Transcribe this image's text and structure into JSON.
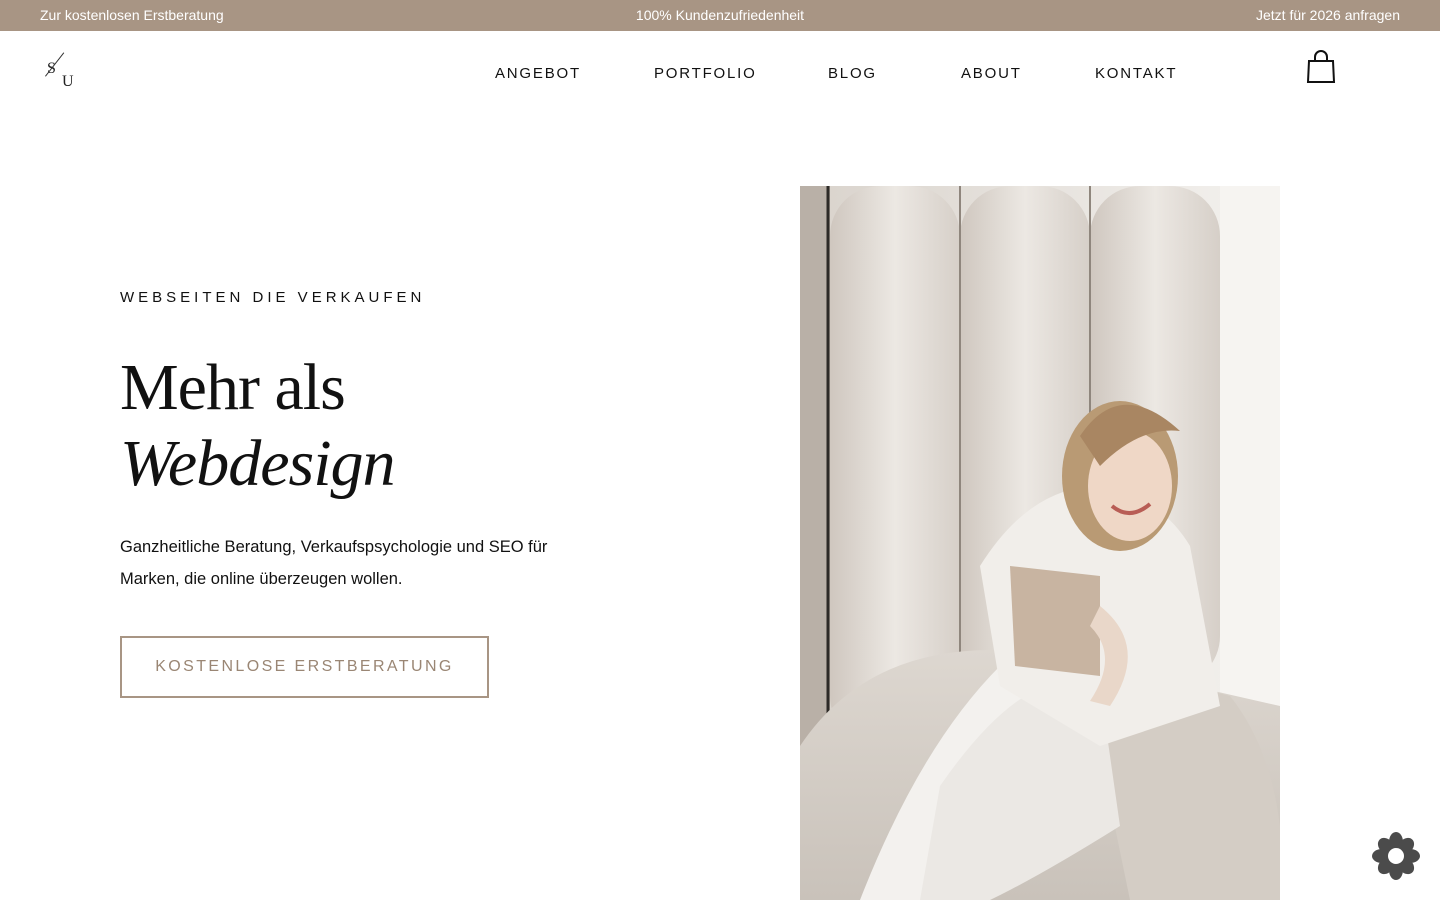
{
  "topbar": {
    "left_link": "Zur kostenlosen Erstberatung",
    "center_text": "100% Kundenzufriedenheit",
    "right_link": "Jetzt für 2026 anfragen"
  },
  "logo": {
    "letter_1": "S",
    "letter_2": "U"
  },
  "nav": {
    "items": [
      {
        "label": "ANGEBOT"
      },
      {
        "label": "PORTFOLIO"
      },
      {
        "label": "BLOG"
      },
      {
        "label": "ABOUT"
      },
      {
        "label": "KONTAKT"
      }
    ],
    "cart_icon": "shopping-bag-icon"
  },
  "hero": {
    "eyebrow": "WEBSEITEN DIE VERKAUFEN",
    "title_line1": "Mehr als",
    "title_line2": "Webdesign",
    "lead": "Ganzheitliche Beratung, Verkaufspsychologie und SEO für Marken, die online überzeugen wollen.",
    "cta_label": "KOSTENLOSE ERSTBERATUNG"
  },
  "colors": {
    "accent": "#a89584",
    "accent_text": "#9a8674",
    "text": "#111111",
    "background": "#ffffff"
  },
  "widget_icon": "flower-badge-icon"
}
